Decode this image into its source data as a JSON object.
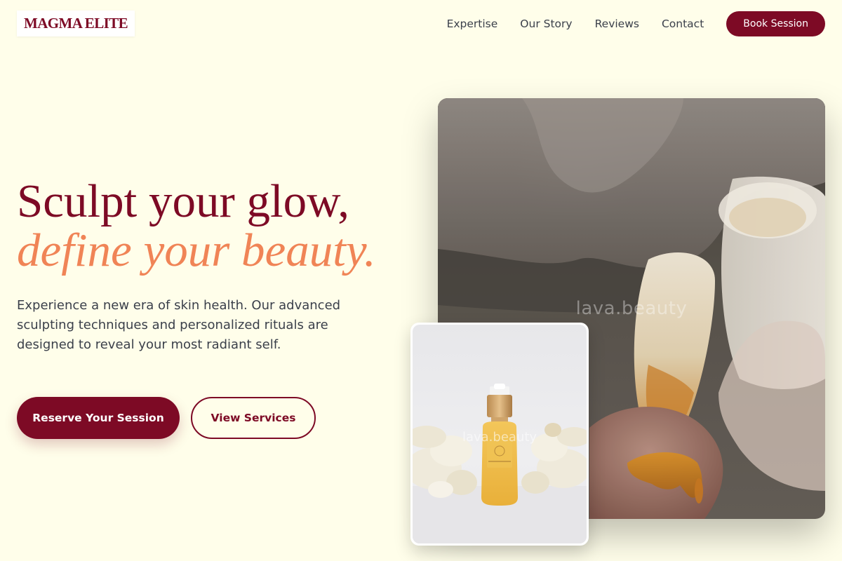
{
  "brand": {
    "logo_text": "MAGMA ELITE"
  },
  "nav": {
    "items": [
      {
        "label": "Expertise"
      },
      {
        "label": "Our Story"
      },
      {
        "label": "Reviews"
      },
      {
        "label": "Contact"
      }
    ],
    "cta_label": "Book Session"
  },
  "hero": {
    "headline_line1": "Sculpt your glow,",
    "headline_line2": "define your beauty.",
    "description": "Experience a new era of skin health. Our advanced sculpting techniques and personalized rituals are designed to reveal your most radiant self.",
    "primary_button": "Reserve Your Session",
    "secondary_button": "View Services"
  },
  "images": {
    "main_watermark": "lava.beauty",
    "product_watermark": "lava.beauty"
  },
  "colors": {
    "background": "#fffeea",
    "brand_primary": "#7d0a25",
    "accent_orange": "#f08456",
    "body_text": "#3a3f4a"
  }
}
